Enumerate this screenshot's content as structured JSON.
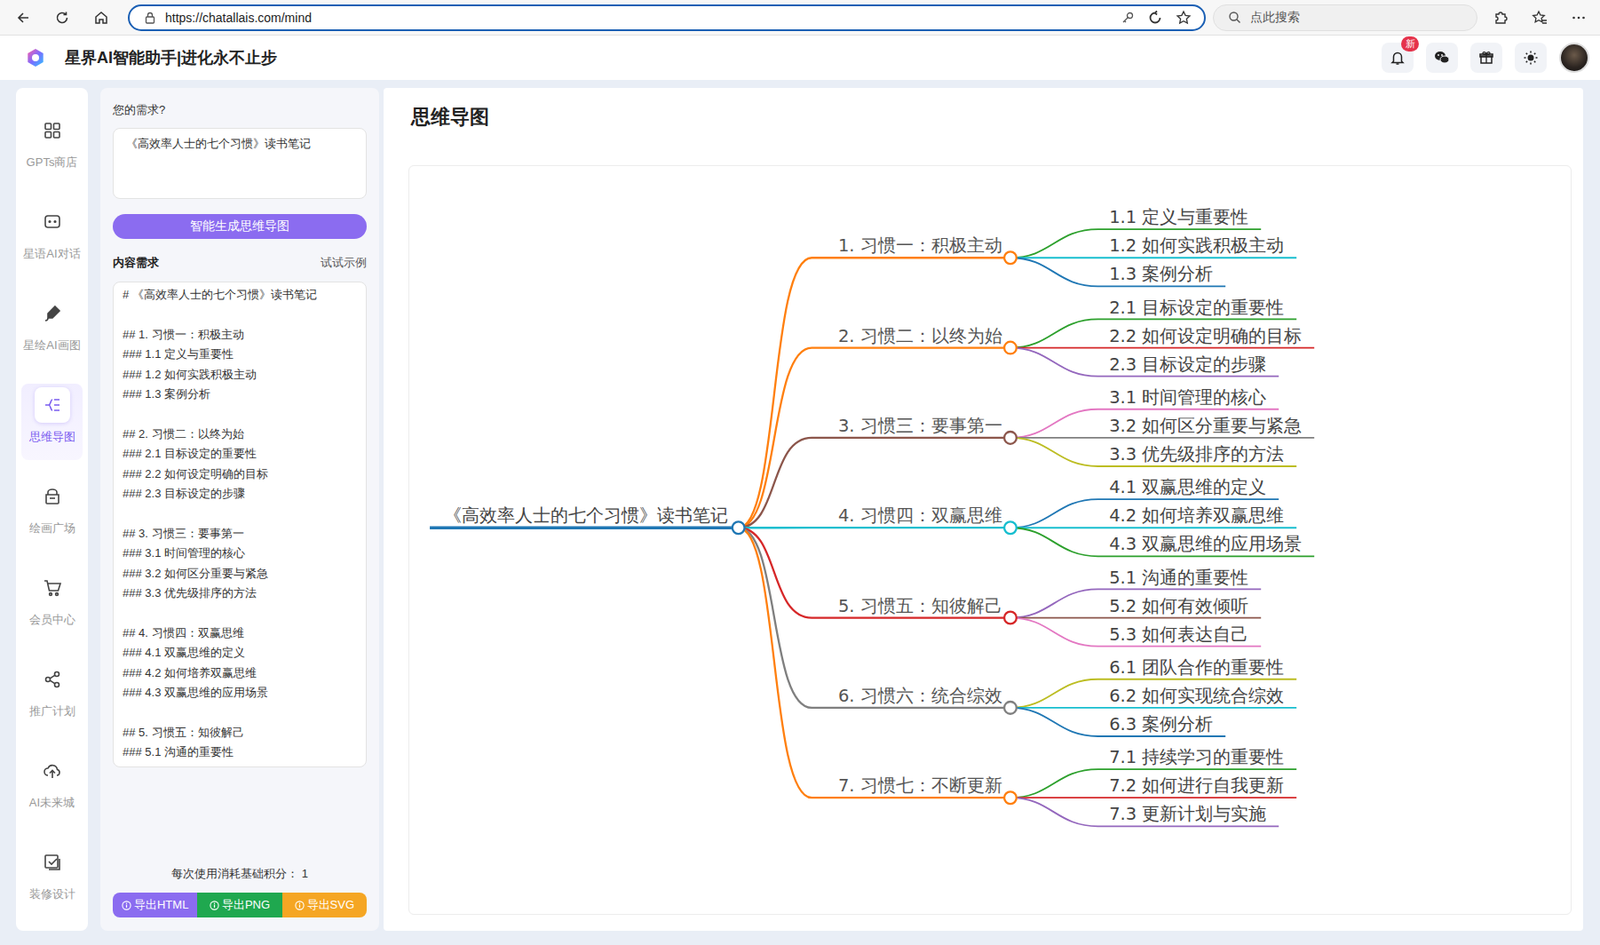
{
  "browser": {
    "url": "https://chatallais.com/mind",
    "search_placeholder": "点此搜索"
  },
  "header": {
    "title": "星界AI智能助手|进化永不止步",
    "notification_badge": "新"
  },
  "sidebar": {
    "items": [
      {
        "label": "GPTs商店",
        "selected": false
      },
      {
        "label": "星语AI对话",
        "selected": false
      },
      {
        "label": "星绘AI画图",
        "selected": false
      },
      {
        "label": "思维导图",
        "selected": true
      },
      {
        "label": "绘画广场",
        "selected": false
      },
      {
        "label": "会员中心",
        "selected": false
      },
      {
        "label": "推广计划",
        "selected": false
      },
      {
        "label": "AI未来城",
        "selected": false
      },
      {
        "label": "装修设计",
        "selected": false
      }
    ]
  },
  "form": {
    "need_label": "您的需求?",
    "need_value": "《高效率人士的七个习惯》读书笔记",
    "generate_button": "智能生成思维导图",
    "content_label": "内容需求",
    "example_link": "试试示例",
    "content_lines": [
      "# 《高效率人士的七个习惯》读书笔记",
      "",
      "## 1. 习惯一：积极主动",
      "### 1.1 定义与重要性",
      "### 1.2 如何实践积极主动",
      "### 1.3 案例分析",
      "",
      "## 2. 习惯二：以终为始",
      "### 2.1 目标设定的重要性",
      "### 2.2 如何设定明确的目标",
      "### 2.3 目标设定的步骤",
      "",
      "## 3. 习惯三：要事第一",
      "### 3.1 时间管理的核心",
      "### 3.2 如何区分重要与紧急",
      "### 3.3 优先级排序的方法",
      "",
      "## 4. 习惯四：双赢思维",
      "### 4.1 双赢思维的定义",
      "### 4.2 如何培养双赢思维",
      "### 4.3 双赢思维的应用场景",
      "",
      "## 5. 习惯五：知彼解己",
      "### 5.1 沟通的重要性"
    ],
    "cost_text": "每次使用消耗基础积分：",
    "cost_value": "1",
    "export_buttons": [
      {
        "label": "导出HTML",
        "color": "#8b6cf0"
      },
      {
        "label": "导出PNG",
        "color": "#1fa84f"
      },
      {
        "label": "导出SVG",
        "color": "#f5a623"
      }
    ]
  },
  "mindmap": {
    "title": "思维导图",
    "root": "《高效率人士的七个习惯》读书笔记",
    "branches": [
      {
        "label": "1. 习惯一：积极主动",
        "color": "#ff7f0e",
        "children": [
          {
            "label": "1.1 定义与重要性",
            "color": "#2ca02c"
          },
          {
            "label": "1.2 如何实践积极主动",
            "color": "#17becf"
          },
          {
            "label": "1.3 案例分析",
            "color": "#1f77b4"
          }
        ]
      },
      {
        "label": "2. 习惯二：以终为始",
        "color": "#ff7f0e",
        "children": [
          {
            "label": "2.1 目标设定的重要性",
            "color": "#2ca02c"
          },
          {
            "label": "2.2 如何设定明确的目标",
            "color": "#d62728"
          },
          {
            "label": "2.3 目标设定的步骤",
            "color": "#9467bd"
          }
        ]
      },
      {
        "label": "3. 习惯三：要事第一",
        "color": "#8c564b",
        "children": [
          {
            "label": "3.1 时间管理的核心",
            "color": "#e377c2"
          },
          {
            "label": "3.2 如何区分重要与紧急",
            "color": "#7f7f7f"
          },
          {
            "label": "3.3 优先级排序的方法",
            "color": "#bcbd22"
          }
        ]
      },
      {
        "label": "4. 习惯四：双赢思维",
        "color": "#17becf",
        "children": [
          {
            "label": "4.1 双赢思维的定义",
            "color": "#1f77b4"
          },
          {
            "label": "4.2 如何培养双赢思维",
            "color": "#17becf"
          },
          {
            "label": "4.3 双赢思维的应用场景",
            "color": "#2ca02c"
          }
        ]
      },
      {
        "label": "5. 习惯五：知彼解己",
        "color": "#d62728",
        "children": [
          {
            "label": "5.1 沟通的重要性",
            "color": "#9467bd"
          },
          {
            "label": "5.2 如何有效倾听",
            "color": "#8c564b"
          },
          {
            "label": "5.3 如何表达自己",
            "color": "#e377c2"
          }
        ]
      },
      {
        "label": "6. 习惯六：统合综效",
        "color": "#7f7f7f",
        "children": [
          {
            "label": "6.1 团队合作的重要性",
            "color": "#bcbd22"
          },
          {
            "label": "6.2 如何实现统合综效",
            "color": "#17becf"
          },
          {
            "label": "6.3 案例分析",
            "color": "#1f77b4"
          }
        ]
      },
      {
        "label": "7. 习惯七：不断更新",
        "color": "#ff7f0e",
        "children": [
          {
            "label": "7.1 持续学习的重要性",
            "color": "#2ca02c"
          },
          {
            "label": "7.2 如何进行自我更新",
            "color": "#d62728"
          },
          {
            "label": "7.3 更新计划与实施",
            "color": "#9467bd"
          }
        ]
      }
    ]
  }
}
